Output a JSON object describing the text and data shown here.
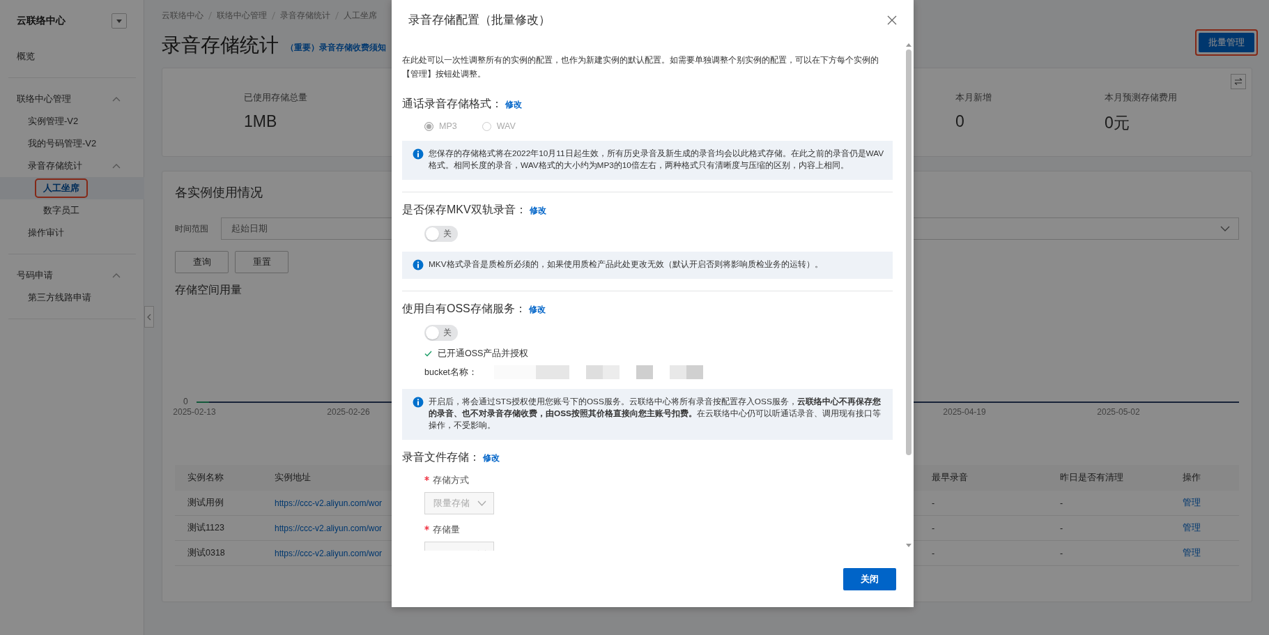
{
  "sidebar": {
    "title": "云联络中心",
    "sections": [
      {
        "items": [
          {
            "label": "概览",
            "selected": false
          }
        ]
      },
      {
        "items": [
          {
            "label": "联络中心管理",
            "expanded": true,
            "children": [
              {
                "label": "实例管理-V2",
                "selected": false
              },
              {
                "label": "我的号码管理-V2",
                "selected": false
              },
              {
                "label": "录音存储统计",
                "expanded": true,
                "children": [
                  {
                    "label": "人工坐席",
                    "selected": true,
                    "annotated": true
                  },
                  {
                    "label": "数字员工",
                    "selected": false
                  }
                ]
              },
              {
                "label": "操作审计",
                "selected": false
              }
            ]
          }
        ]
      },
      {
        "items": [
          {
            "label": "号码申请",
            "expanded": true,
            "children": [
              {
                "label": "第三方线路申请",
                "selected": false
              }
            ]
          }
        ]
      }
    ]
  },
  "breadcrumb": [
    "云联络中心",
    "联络中心管理",
    "录音存储统计",
    "人工坐席"
  ],
  "page": {
    "title": "录音存储统计",
    "notice_link": "（重要）录音存储收费须知",
    "batch_button": {
      "label": "批量管理",
      "annotated": true
    }
  },
  "stats": [
    {
      "label": "已使用存储总量",
      "value": "1MB"
    },
    {
      "label": "本月新增",
      "value": "0"
    },
    {
      "label": "本月预测存储费用",
      "value": "0元"
    }
  ],
  "usage": {
    "title": "各实例使用情况",
    "time_range": {
      "label": "时间范围",
      "placeholder": "起始日期"
    },
    "buttons": [
      "查询",
      "重置"
    ],
    "chart": {
      "title": "存储空间用量",
      "y_tick": "0",
      "x_ticks": [
        "2025-02-13",
        "2025-02-26",
        "2025-04-19",
        "2025-05-02"
      ]
    },
    "table": {
      "columns": [
        "实例名称",
        "实例地址",
        "最早录音",
        "昨日是否有清理",
        "操作"
      ],
      "rows": [
        {
          "cells": [
            "测试用例",
            "https://ccc-v2.aliyun.com/wor",
            "-",
            "-",
            "管理"
          ]
        },
        {
          "cells": [
            "测试1123",
            "https://ccc-v2.aliyun.com/wor",
            "-",
            "-",
            "管理"
          ]
        },
        {
          "cells": [
            "测试0318",
            "https://ccc-v2.aliyun.com/wor",
            "-",
            "-",
            "管理"
          ]
        }
      ]
    }
  },
  "modal": {
    "title": "录音存储配置（批量修改）",
    "intro": "在此处可以一次性调整所有的实例的配置，也作为新建实例的默认配置。如需要单独调整个别实例的配置，可以在下方每个实例的【管理】按钮处调整。",
    "sections": [
      {
        "kind": "radio",
        "heading": "通话录音存储格式：",
        "edit_link": "修改",
        "disabled": true,
        "options": [
          {
            "label": "MP3",
            "selected": true
          },
          {
            "label": "WAV",
            "selected": false
          }
        ],
        "alert": "您保存的存储格式将在2022年10月11日起生效，所有历史录音及新生成的录音均会以此格式存储。在此之前的录音仍是WAV格式。相同长度的录音，WAV格式的大小约为MP3的10倍左右，两种格式只有清晰度与压缩的区别，内容上相同。"
      },
      {
        "kind": "switch",
        "heading": "是否保存MKV双轨录音：",
        "edit_link": "修改",
        "switch": {
          "on": false,
          "label": "关"
        },
        "alert": "MKV格式录音是质检所必须的，如果使用质检产品此处更改无效（默认开启否则将影响质检业务的运转）。"
      },
      {
        "kind": "oss",
        "heading": "使用自有OSS存储服务：",
        "edit_link": "修改",
        "switch": {
          "on": false,
          "label": "关"
        },
        "status": "已开通OSS产品并授权",
        "bucket_label": "bucket名称：",
        "alert": "开启后，将会通过STS授权使用您账号下的OSS服务。云联络中心将所有录音按配置存入OSS服务，**云联络中心不再保存您的录音、也不对录音存储收费，由OSS按照其价格直接向您主账号扣费。**在云联络中心仍可以听通话录音、调用现有接口等操作，不受影响。"
      },
      {
        "kind": "form",
        "heading": "录音文件存储：",
        "edit_link": "修改",
        "fields": [
          {
            "label": "存储方式",
            "required": true,
            "disabled": true,
            "value": "限量存储"
          },
          {
            "label": "存储量",
            "required": true,
            "disabled": true
          }
        ]
      }
    ],
    "close_button": "关闭"
  }
}
